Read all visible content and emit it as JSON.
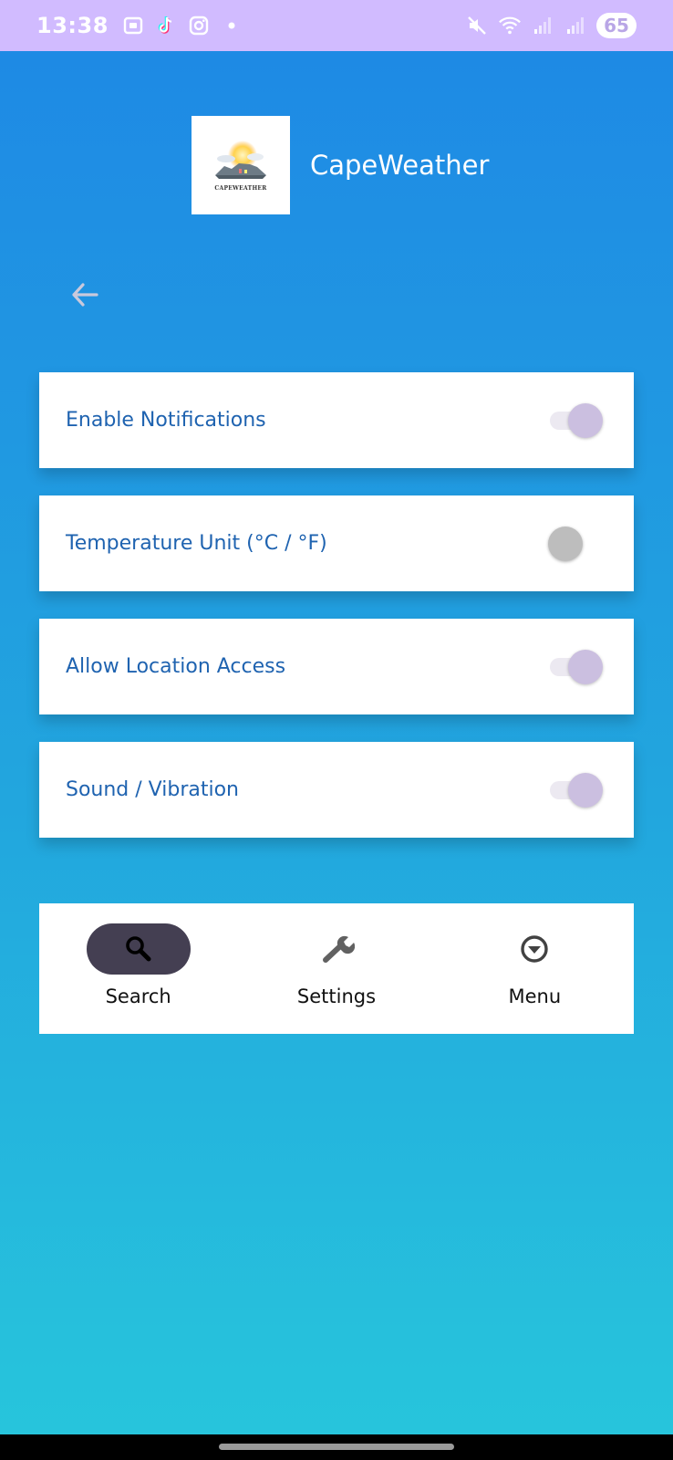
{
  "status_bar": {
    "time": "13:38",
    "left_icons": [
      "screenshot-icon",
      "tiktok-icon",
      "instagram-icon",
      "dot-icon"
    ],
    "right_icons": [
      "mute-icon",
      "wifi-icon",
      "signal-icon",
      "signal-icon"
    ],
    "battery": "65"
  },
  "header": {
    "logo_text": "CAPEWEATHER",
    "title": "CapeWeather"
  },
  "settings": [
    {
      "label": "Enable Notifications",
      "enabled": true
    },
    {
      "label": "Temperature Unit (°C / °F)",
      "enabled": false
    },
    {
      "label": "Allow Location Access",
      "enabled": true
    },
    {
      "label": "Sound / Vibration",
      "enabled": true
    }
  ],
  "bottom_nav": {
    "items": [
      {
        "label": "Search",
        "icon": "search-icon",
        "active": true
      },
      {
        "label": "Settings",
        "icon": "wrench-icon",
        "active": false
      },
      {
        "label": "Menu",
        "icon": "chevron-circle-down-icon",
        "active": false
      }
    ]
  },
  "colors": {
    "status_bar": "#d1bbff",
    "background_top": "#1e88e5",
    "background_bottom": "#27c6dc",
    "setting_label": "#1f63b0",
    "toggle_on_thumb": "#cbbfe0",
    "toggle_off_thumb": "#bdbdbd",
    "nav_active_pill": "#443f52"
  }
}
